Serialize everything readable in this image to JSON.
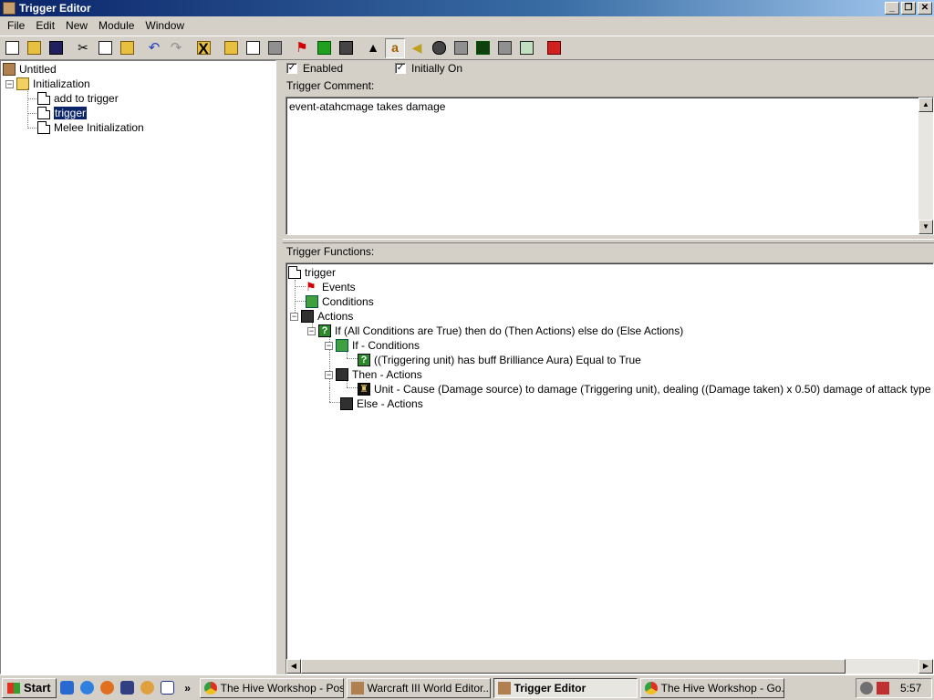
{
  "window": {
    "title": "Trigger Editor"
  },
  "menu": [
    "File",
    "Edit",
    "New",
    "Module",
    "Window"
  ],
  "toolbar_icons": [
    "new-icon",
    "open-icon",
    "save-icon",
    "cut-icon",
    "copy-icon",
    "paste-icon",
    "undo-icon",
    "redo-icon",
    "delete-icon",
    "new-category-icon",
    "new-trigger-icon",
    "new-comment-icon",
    "new-event-icon",
    "new-condition-icon",
    "new-action-icon",
    "terrain-editor-icon",
    "trigger-editor-icon",
    "sound-editor-icon",
    "object-editor-icon",
    "campaign-editor-icon",
    "ai-editor-icon",
    "import-manager-icon",
    "object-manager-icon",
    "test-map-icon"
  ],
  "tree": {
    "map_name": "Untitled",
    "category": "Initialization",
    "items": [
      "add to trigger",
      "trigger",
      "Melee Initialization"
    ],
    "selected": "trigger"
  },
  "options": {
    "enabled_label": "Enabled",
    "enabled_checked": true,
    "initially_on_label": "Initially On",
    "initially_on_checked": true,
    "check_mark": "✓"
  },
  "comment": {
    "label": "Trigger Comment:",
    "text": "event-atahcmage takes damage"
  },
  "functions": {
    "label": "Trigger Functions:",
    "root": "trigger",
    "events": "Events",
    "conditions": "Conditions",
    "actions": "Actions",
    "if_then_else": "If (All Conditions are True) then do (Then Actions) else do (Else Actions)",
    "if_conditions": "If - Conditions",
    "condition_line": "((Triggering unit) has buff Brilliance Aura) Equal to True",
    "then_actions": "Then - Actions",
    "action_line": "Unit - Cause (Damage source) to damage (Triggering unit), dealing ((Damage taken) x 0.50) damage of attack type Normal and dar",
    "else_actions": "Else - Actions"
  },
  "taskbar": {
    "start_label": "Start",
    "more": "»",
    "tasks": [
      {
        "label": "The Hive Workshop - Pos...",
        "active": false
      },
      {
        "label": "Warcraft III World Editor...",
        "active": false
      },
      {
        "label": "Trigger Editor",
        "active": true
      },
      {
        "label": "The Hive Workshop - Go...",
        "active": false
      }
    ],
    "clock": "5:57"
  },
  "colors": {
    "titlebar": "#0a246a",
    "selection": "#0a246a",
    "face": "#d4d0c8"
  }
}
